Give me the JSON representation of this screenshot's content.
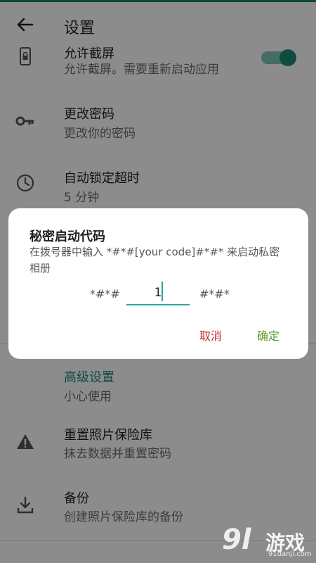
{
  "header": {
    "title": "设置"
  },
  "rows": [
    {
      "title": "允许截屏",
      "sub": "允许截屏。需要重新启动应用",
      "icon": "phone-lock-icon"
    },
    {
      "title": "更改密码",
      "sub": "更改你的密码",
      "icon": "key-icon"
    },
    {
      "title": "自动锁定超时",
      "sub": "5 分钟",
      "icon": "clock-icon"
    },
    {
      "title": "高级设置",
      "sub": "小心使用",
      "icon": ""
    },
    {
      "title": "重置照片保险库",
      "sub": "抹去数据并重置密码",
      "icon": "warning-icon"
    },
    {
      "title": "备份",
      "sub": "创建照片保险库的备份",
      "icon": "download-icon"
    }
  ],
  "dialog": {
    "title": "秘密启动代码",
    "message": "在拨号器中输入 *#*#[your code]#*#* 来启动私密相册",
    "prefix": "*#*#",
    "suffix": "#*#*",
    "input_value": "1",
    "cancel_label": "取消",
    "ok_label": "确定"
  },
  "watermark": {
    "number": "9l",
    "text": "游戏",
    "url": "91danji.com"
  },
  "colors": {
    "accent": "#1f8a7a",
    "cancel": "#c62828",
    "ok": "#5a9a1a"
  }
}
